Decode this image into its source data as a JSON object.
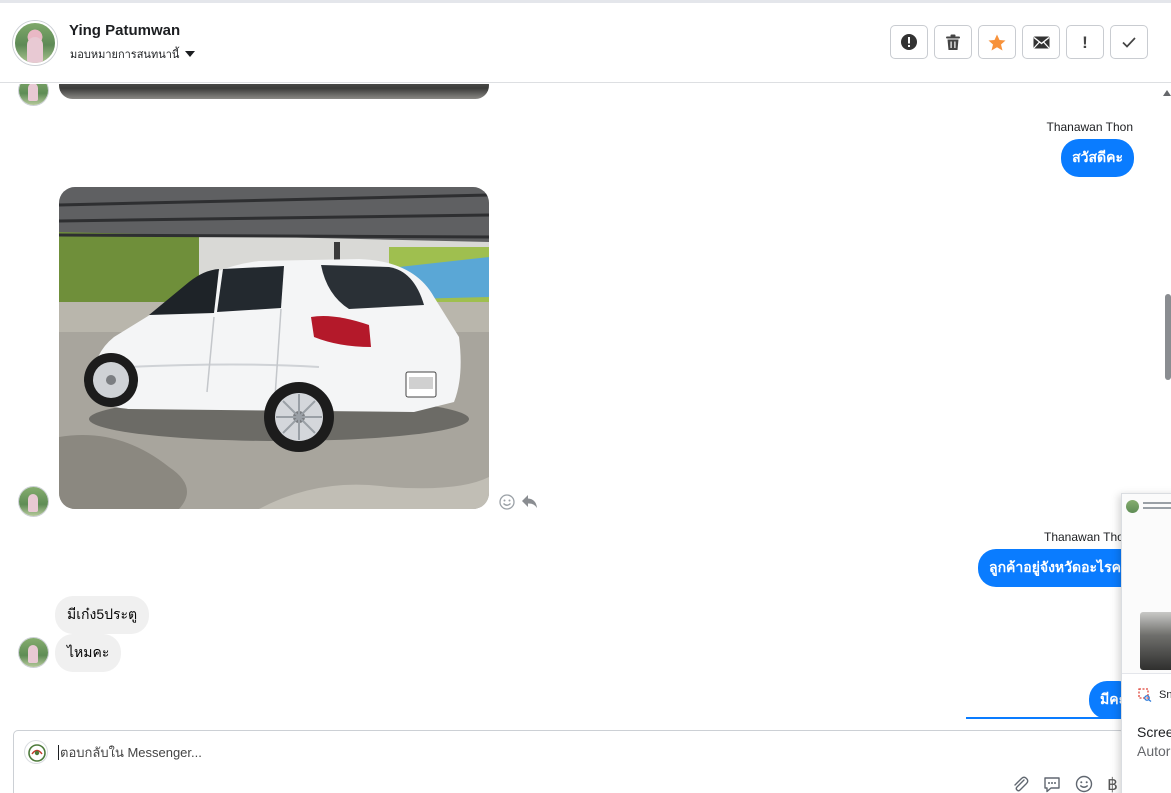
{
  "header": {
    "contact_name": "Ying Patumwan",
    "assign_label": "มอบหมายการสนทนานี้",
    "actions": [
      {
        "icon": "spam-alert-icon"
      },
      {
        "icon": "trash-icon"
      },
      {
        "icon": "star-icon",
        "color": "#f7923b"
      },
      {
        "icon": "envelope-icon"
      },
      {
        "icon": "exclamation-icon",
        "glyph": "!"
      },
      {
        "icon": "checkmark-icon"
      }
    ]
  },
  "thread": {
    "messages": [
      {
        "direction": "incoming",
        "type": "image",
        "partial": true
      },
      {
        "direction": "outgoing",
        "sender": "Thanawan Thon",
        "text": "สวัสดีคะ"
      },
      {
        "direction": "incoming",
        "type": "image",
        "subject": "white hatchback car under carport"
      },
      {
        "direction": "outgoing",
        "sender": "Thanawan Thon",
        "text": "ลูกค้าอยู่จังหวัดอะไรคะ"
      },
      {
        "direction": "incoming",
        "text": "มีเก๋ง5ประตู"
      },
      {
        "direction": "incoming",
        "text": "ไหมคะ"
      },
      {
        "direction": "outgoing",
        "text": "มีคะ"
      }
    ],
    "reaction_icons": [
      "smiley-icon",
      "reply-icon"
    ]
  },
  "composer": {
    "placeholder": "ตอบกลับใน Messenger...",
    "tools": [
      "attachment-icon",
      "saved-reply-icon",
      "emoji-icon",
      "baht-icon"
    ],
    "baht_glyph": "฿"
  },
  "snip_popup": {
    "app_label": "Sn",
    "title": "Scree",
    "subtitle": "Autor"
  },
  "colors": {
    "messenger_blue": "#0a7cff",
    "incoming_bubble": "#f0f0f0",
    "star_orange": "#f7923b"
  }
}
